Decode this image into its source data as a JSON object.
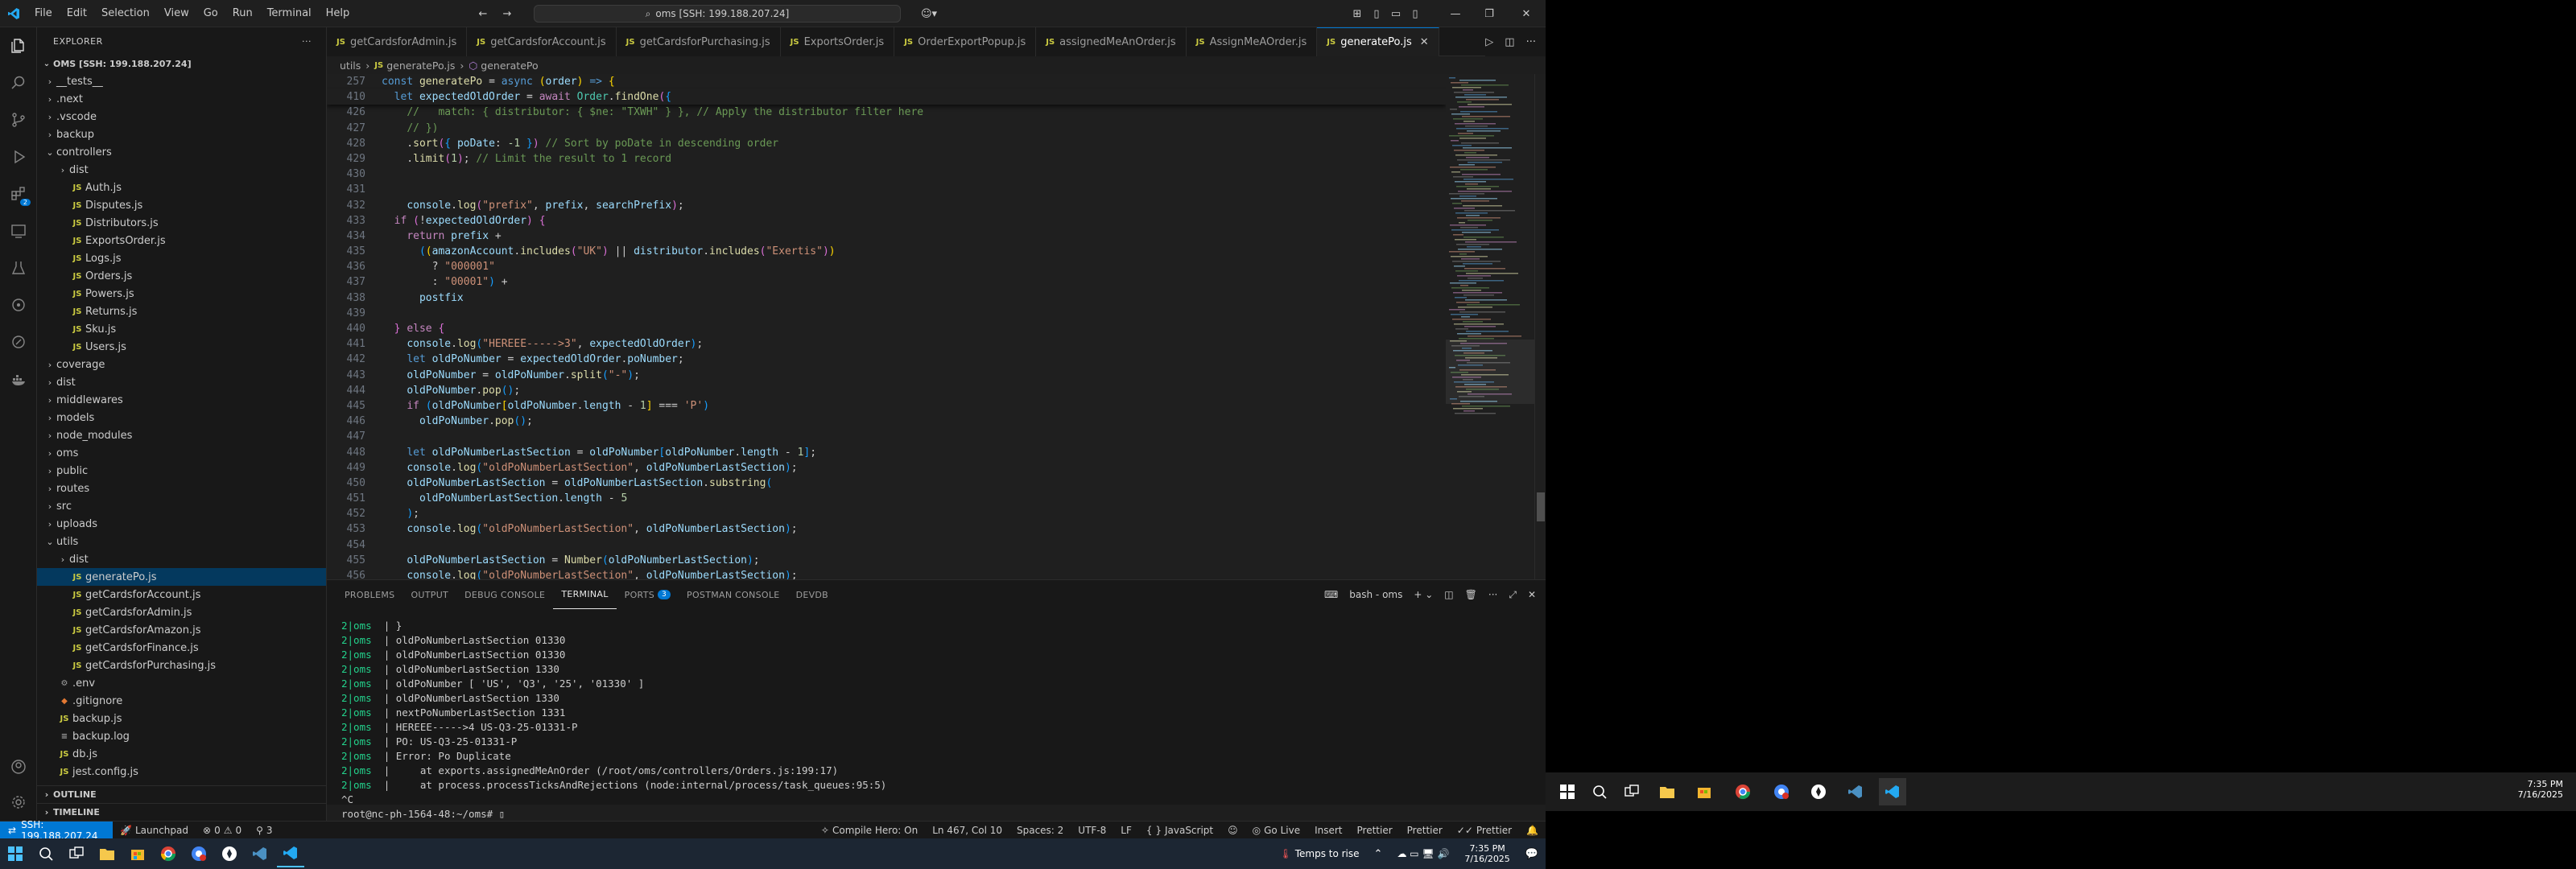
{
  "title_bar": {
    "menus": [
      "File",
      "Edit",
      "Selection",
      "View",
      "Go",
      "Run",
      "Terminal",
      "Help"
    ],
    "command_center": "oms [SSH: 199.188.207.24]"
  },
  "sidebar": {
    "header": "EXPLORER",
    "root": "OMS [SSH: 199.188.207.24]",
    "items": [
      {
        "label": "__tests__",
        "type": "folder",
        "depth": 0,
        "open": false
      },
      {
        "label": ".next",
        "type": "folder",
        "depth": 0,
        "open": false
      },
      {
        "label": ".vscode",
        "type": "folder",
        "depth": 0,
        "open": false
      },
      {
        "label": "backup",
        "type": "folder",
        "depth": 0,
        "open": false
      },
      {
        "label": "controllers",
        "type": "folder",
        "depth": 0,
        "open": true
      },
      {
        "label": "dist",
        "type": "folder",
        "depth": 1,
        "open": false
      },
      {
        "label": "Auth.js",
        "type": "js",
        "depth": 1
      },
      {
        "label": "Disputes.js",
        "type": "js",
        "depth": 1
      },
      {
        "label": "Distributors.js",
        "type": "js",
        "depth": 1
      },
      {
        "label": "ExportsOrder.js",
        "type": "js",
        "depth": 1
      },
      {
        "label": "Logs.js",
        "type": "js",
        "depth": 1
      },
      {
        "label": "Orders.js",
        "type": "js",
        "depth": 1
      },
      {
        "label": "Powers.js",
        "type": "js",
        "depth": 1
      },
      {
        "label": "Returns.js",
        "type": "js",
        "depth": 1
      },
      {
        "label": "Sku.js",
        "type": "js",
        "depth": 1
      },
      {
        "label": "Users.js",
        "type": "js",
        "depth": 1
      },
      {
        "label": "coverage",
        "type": "folder",
        "depth": 0,
        "open": false
      },
      {
        "label": "dist",
        "type": "folder",
        "depth": 0,
        "open": false
      },
      {
        "label": "middlewares",
        "type": "folder",
        "depth": 0,
        "open": false
      },
      {
        "label": "models",
        "type": "folder",
        "depth": 0,
        "open": false
      },
      {
        "label": "node_modules",
        "type": "folder",
        "depth": 0,
        "open": false
      },
      {
        "label": "oms",
        "type": "folder",
        "depth": 0,
        "open": false
      },
      {
        "label": "public",
        "type": "folder",
        "depth": 0,
        "open": false
      },
      {
        "label": "routes",
        "type": "folder",
        "depth": 0,
        "open": false
      },
      {
        "label": "src",
        "type": "folder",
        "depth": 0,
        "open": false
      },
      {
        "label": "uploads",
        "type": "folder",
        "depth": 0,
        "open": false
      },
      {
        "label": "utils",
        "type": "folder",
        "depth": 0,
        "open": true
      },
      {
        "label": "dist",
        "type": "folder",
        "depth": 1,
        "open": false
      },
      {
        "label": "generatePo.js",
        "type": "js",
        "depth": 1,
        "selected": true
      },
      {
        "label": "getCardsforAccount.js",
        "type": "js",
        "depth": 1
      },
      {
        "label": "getCardsforAdmin.js",
        "type": "js",
        "depth": 1
      },
      {
        "label": "getCardsforAmazon.js",
        "type": "js",
        "depth": 1
      },
      {
        "label": "getCardsforFinance.js",
        "type": "js",
        "depth": 1
      },
      {
        "label": "getCardsforPurchasing.js",
        "type": "js",
        "depth": 1
      },
      {
        "label": ".env",
        "type": "gear",
        "depth": 0
      },
      {
        "label": ".gitignore",
        "type": "git",
        "depth": 0
      },
      {
        "label": "backup.js",
        "type": "js",
        "depth": 0
      },
      {
        "label": "backup.log",
        "type": "log",
        "depth": 0
      },
      {
        "label": "db.js",
        "type": "js",
        "depth": 0
      },
      {
        "label": "jest.config.js",
        "type": "js",
        "depth": 0
      }
    ],
    "outline_label": "OUTLINE",
    "timeline_label": "TIMELINE"
  },
  "tabs": [
    {
      "label": "getCardsforAdmin.js",
      "active": false
    },
    {
      "label": "getCardsforAccount.js",
      "active": false
    },
    {
      "label": "getCardsforPurchasing.js",
      "active": false
    },
    {
      "label": "ExportsOrder.js",
      "active": false
    },
    {
      "label": "OrderExportPopup.js",
      "active": false
    },
    {
      "label": "assignedMeAnOrder.js",
      "active": false
    },
    {
      "label": "AssignMeAOrder.js",
      "active": false
    },
    {
      "label": "generatePo.js",
      "active": true
    }
  ],
  "breadcrumb": {
    "folder": "utils",
    "file": "generatePo.js",
    "symbol": "generatePo"
  },
  "code": [
    {
      "ln": "257",
      "sticky": true,
      "html": "<span class='kw'>const</span> <span class='fn'>generatePo</span> <span class='pn'>=</span> <span class='kw'>async</span> <span class='br1'>(</span><span class='var'>order</span><span class='br1'>)</span> <span class='kw'>=></span> <span class='br1'>{</span>"
    },
    {
      "ln": "410",
      "sticky": true,
      "html": "  <span class='kw'>let</span> <span class='var'>expectedOldOrder</span> <span class='pn'>=</span> <span class='ctl'>await</span> <span class='cls'>Order</span>.<span class='fn'>findOne</span><span class='br2'>(</span><span class='br3'>{</span>"
    },
    {
      "ln": "426",
      "html": "    <span class='cm'>//   match: { distributor: { $ne: \"TXWH\" } }, // Apply the distributor filter here</span>"
    },
    {
      "ln": "427",
      "html": "    <span class='cm'>// })</span>"
    },
    {
      "ln": "428",
      "html": "    .<span class='fn'>sort</span><span class='br2'>(</span><span class='br3'>{</span> <span class='var'>poDate</span>: <span class='num'>-1</span> <span class='br3'>}</span><span class='br2'>)</span> <span class='cm'>// Sort by poDate in descending order</span>"
    },
    {
      "ln": "429",
      "html": "    .<span class='fn'>limit</span><span class='br2'>(</span><span class='num'>1</span><span class='br2'>)</span>; <span class='cm'>// Limit the result to 1 record</span>"
    },
    {
      "ln": "430",
      "html": ""
    },
    {
      "ln": "431",
      "html": ""
    },
    {
      "ln": "432",
      "html": "    <span class='var'>console</span>.<span class='fn'>log</span><span class='br2'>(</span><span class='str'>\"prefix\"</span>, <span class='var'>prefix</span>, <span class='var'>searchPrefix</span><span class='br2'>)</span>;"
    },
    {
      "ln": "433",
      "html": "  <span class='ctl'>if</span> <span class='br2'>(</span>!<span class='var'>expectedOldOrder</span><span class='br2'>)</span> <span class='br2'>{</span>"
    },
    {
      "ln": "434",
      "html": "    <span class='ctl'>return</span> <span class='var'>prefix</span> +"
    },
    {
      "ln": "435",
      "html": "      <span class='br3'>(</span><span class='br1'>(</span><span class='var'>amazonAccount</span>.<span class='fn'>includes</span><span class='br2'>(</span><span class='str'>\"UK\"</span><span class='br2'>)</span> || <span class='var'>distributor</span>.<span class='fn'>includes</span><span class='br2'>(</span><span class='str'>\"Exertis\"</span><span class='br2'>)</span><span class='br1'>)</span>"
    },
    {
      "ln": "436",
      "html": "        ? <span class='str'>\"000001\"</span>"
    },
    {
      "ln": "437",
      "html": "        : <span class='str'>\"00001\"</span><span class='br3'>)</span> +"
    },
    {
      "ln": "438",
      "html": "      <span class='var'>postfix</span>"
    },
    {
      "ln": "439",
      "html": ""
    },
    {
      "ln": "440",
      "html": "  <span class='br2'>}</span> <span class='ctl'>else</span> <span class='br2'>{</span>"
    },
    {
      "ln": "441",
      "html": "    <span class='var'>console</span>.<span class='fn'>log</span><span class='br3'>(</span><span class='str'>\"HEREEE----->3\"</span>, <span class='var'>expectedOldOrder</span><span class='br3'>)</span>;"
    },
    {
      "ln": "442",
      "html": "    <span class='kw'>let</span> <span class='var'>oldPoNumber</span> = <span class='var'>expectedOldOrder</span>.<span class='var'>poNumber</span>;"
    },
    {
      "ln": "443",
      "html": "    <span class='var'>oldPoNumber</span> = <span class='var'>oldPoNumber</span>.<span class='fn'>split</span><span class='br3'>(</span><span class='str'>\"-\"</span><span class='br3'>)</span>;"
    },
    {
      "ln": "444",
      "html": "    <span class='var'>oldPoNumber</span>.<span class='fn'>pop</span><span class='br3'>()</span>;"
    },
    {
      "ln": "445",
      "html": "    <span class='ctl'>if</span> <span class='br3'>(</span><span class='var'>oldPoNumber</span><span class='br1'>[</span><span class='var'>oldPoNumber</span>.<span class='var'>length</span> - <span class='num'>1</span><span class='br1'>]</span> === <span class='str'>'P'</span><span class='br3'>)</span>"
    },
    {
      "ln": "446",
      "html": "      <span class='var'>oldPoNumber</span>.<span class='fn'>pop</span><span class='br3'>()</span>;"
    },
    {
      "ln": "447",
      "html": ""
    },
    {
      "ln": "448",
      "html": "    <span class='kw'>let</span> <span class='var'>oldPoNumberLastSection</span> = <span class='var'>oldPoNumber</span><span class='br3'>[</span><span class='var'>oldPoNumber</span>.<span class='var'>length</span> - <span class='num'>1</span><span class='br3'>]</span>;"
    },
    {
      "ln": "449",
      "html": "    <span class='var'>console</span>.<span class='fn'>log</span><span class='br3'>(</span><span class='str'>\"oldPoNumberLastSection\"</span>, <span class='var'>oldPoNumberLastSection</span><span class='br3'>)</span>;"
    },
    {
      "ln": "450",
      "html": "    <span class='var'>oldPoNumberLastSection</span> = <span class='var'>oldPoNumberLastSection</span>.<span class='fn'>substring</span><span class='br3'>(</span>"
    },
    {
      "ln": "451",
      "html": "      <span class='var'>oldPoNumberLastSection</span>.<span class='var'>length</span> - <span class='num'>5</span>"
    },
    {
      "ln": "452",
      "html": "    <span class='br3'>)</span>;"
    },
    {
      "ln": "453",
      "html": "    <span class='var'>console</span>.<span class='fn'>log</span><span class='br3'>(</span><span class='str'>\"oldPoNumberLastSection\"</span>, <span class='var'>oldPoNumberLastSection</span><span class='br3'>)</span>;"
    },
    {
      "ln": "454",
      "html": ""
    },
    {
      "ln": "455",
      "html": "    <span class='var'>oldPoNumberLastSection</span> = <span class='fn'>Number</span><span class='br3'>(</span><span class='var'>oldPoNumberLastSection</span><span class='br3'>)</span>;"
    },
    {
      "ln": "456",
      "html": "    <span class='var'>console</span>.<span class='fn'>log</span><span class='br3'>(</span><span class='str'>\"oldPoNumberLastSection\"</span>, <span class='var'>oldPoNumberLastSection</span><span class='br3'>)</span>;"
    }
  ],
  "panel": {
    "tabs": [
      "PROBLEMS",
      "OUTPUT",
      "DEBUG CONSOLE",
      "TERMINAL",
      "PORTS",
      "POSTMAN CONSOLE",
      "DEVDB"
    ],
    "ports_count": "3",
    "active": "TERMINAL",
    "terminal_name": "bash - oms",
    "lines": [
      {
        "pre": "2|oms",
        "text": "  | }"
      },
      {
        "pre": "2|oms",
        "text": "  | oldPoNumberLastSection 01330"
      },
      {
        "pre": "2|oms",
        "text": "  | oldPoNumberLastSection 01330"
      },
      {
        "pre": "2|oms",
        "text": "  | oldPoNumberLastSection 1330"
      },
      {
        "pre": "2|oms",
        "text": "  | oldPoNumber [ 'US', 'Q3', '25', '01330' ]"
      },
      {
        "pre": "2|oms",
        "text": "  | oldPoNumberLastSection 1330"
      },
      {
        "pre": "2|oms",
        "text": "  | nextPoNumberLastSection 1331"
      },
      {
        "pre": "2|oms",
        "text": "  | HEREEE----->4 US-Q3-25-01331-P"
      },
      {
        "pre": "2|oms",
        "text": "  | PO: US-Q3-25-01331-P"
      },
      {
        "pre": "2|oms",
        "text": "  | Error: Po Duplicate"
      },
      {
        "pre": "2|oms",
        "text": "  |     at exports.assignedMeAnOrder (/root/oms/controllers/Orders.js:199:17)"
      },
      {
        "pre": "2|oms",
        "text": "  |     at process.processTicksAndRejections (node:internal/process/task_queues:95:5)"
      },
      {
        "pre": "",
        "text": "^C"
      },
      {
        "pre": "",
        "text": "root@nc-ph-1564-48:~/oms# "
      }
    ]
  },
  "statusbar": {
    "remote": "SSH: 199.188.207.24",
    "launchpad": "Launchpad",
    "errors": "0",
    "warnings": "0",
    "ports": "3",
    "compile_hero": "Compile Hero: On",
    "cursor": "Ln 467, Col 10",
    "spaces": "Spaces: 2",
    "encoding": "UTF-8",
    "eol": "LF",
    "language": "JavaScript",
    "golive": "Go Live",
    "insert": "Insert",
    "prettier1": "Prettier",
    "prettier2": "Prettier",
    "prettier3": "Prettier"
  },
  "taskbar_left": {
    "weather": "Temps to rise",
    "time": "7:35 PM",
    "date": "7/16/2025"
  },
  "taskbar_right": {
    "time": "7:35 PM",
    "date": "7/16/2025"
  },
  "colors": {
    "accent": "#0078d4",
    "editor_bg": "#1f1f1f",
    "sidebar_bg": "#181818"
  }
}
